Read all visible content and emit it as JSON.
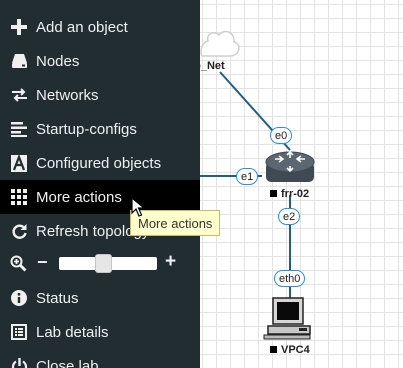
{
  "sidebar": {
    "items": [
      {
        "label": "Add an object",
        "icon": "plus-icon"
      },
      {
        "label": "Nodes",
        "icon": "hard-drive-icon"
      },
      {
        "label": "Networks",
        "icon": "exchange-arrows-icon"
      },
      {
        "label": "Startup-configs",
        "icon": "align-left-icon"
      },
      {
        "label": "Configured objects",
        "icon": "font-a-icon"
      },
      {
        "label": "More actions",
        "icon": "grid-icon",
        "active": true
      },
      {
        "label": "Refresh topology",
        "icon": "refresh-icon"
      },
      {
        "label": "Status",
        "icon": "info-circle-icon"
      },
      {
        "label": "Lab details",
        "icon": "list-alt-icon"
      },
      {
        "label": "Close lab",
        "icon": "power-icon"
      }
    ],
    "zoom": {
      "minus": "−",
      "plus": "+",
      "level": 0.45
    }
  },
  "tooltip": {
    "text": "More actions"
  },
  "topology": {
    "network": {
      "label": "ab_Net",
      "icon": "cloud-icon"
    },
    "router": {
      "label": "frr-02",
      "icon": "router-icon"
    },
    "vpc": {
      "label": "VPC4",
      "icon": "computer-icon"
    },
    "interfaces": {
      "e0": "e0",
      "e1": "e1",
      "e2": "e2",
      "eth0": "eth0"
    }
  },
  "colors": {
    "sidebar_bg": "#222d32",
    "active_bg": "#000000",
    "link": "#1f5f87",
    "iface_border": "#2d8fd8",
    "tooltip_bg": "#ffffcc"
  }
}
